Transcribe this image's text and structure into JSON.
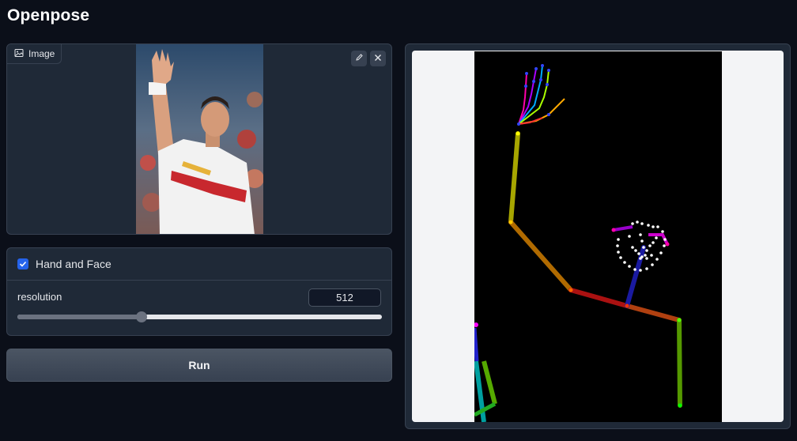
{
  "app": {
    "title": "Openpose"
  },
  "image_input": {
    "label": "Image",
    "label_icon": "image-icon",
    "edit_icon": "pencil-icon",
    "clear_icon": "close-icon"
  },
  "controls": {
    "hand_face": {
      "label": "Hand and Face",
      "checked": true
    },
    "resolution": {
      "label": "resolution",
      "value": "512",
      "slider_fraction": 0.34
    }
  },
  "run_button": {
    "label": "Run"
  },
  "colors": {
    "background": "#0b0f19",
    "panel": "#1f2937",
    "accent": "#2563eb",
    "output_bg": "#f3f4f6"
  }
}
